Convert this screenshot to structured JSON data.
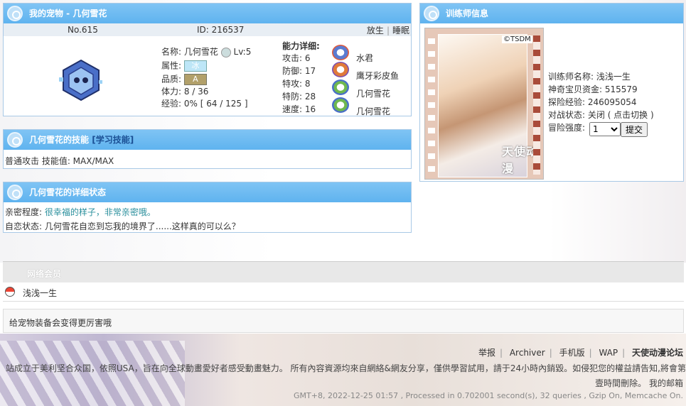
{
  "pet_panel": {
    "title": "我的宠物 - 几何雪花",
    "number": "No.615",
    "id_label": "ID: 216537",
    "release": "放生",
    "sleep": "睡眠",
    "name_label": "名称:",
    "name": "几何雪花",
    "level": "Lv:5",
    "attr_label": "属性:",
    "attr": "冰",
    "quality_label": "品质:",
    "quality": "A",
    "hp": "体力: 8 / 36",
    "exp": "经验: 0% [ 64 / 125 ]",
    "abilities_title": "能力详细:",
    "stats": [
      {
        "label": "攻击: 6",
        "pokemon": "水君"
      },
      {
        "label": "防御: 17",
        "pokemon": "鹰牙彩皮鱼"
      },
      {
        "label": "特攻: 8",
        "pokemon": "几何雪花"
      },
      {
        "label": "特防: 28",
        "pokemon": "几何雪花"
      },
      {
        "label": "速度: 16",
        "pokemon": ""
      }
    ]
  },
  "skills_panel": {
    "title": "几何雪花的技能",
    "learn_link": "[学习技能]",
    "text": "普通攻击 技能值: MAX/MAX"
  },
  "detail_panel": {
    "title": "几何雪花的详细状态",
    "intimacy_label": "亲密程度:",
    "intimacy_value": "很幸福的样子，非常亲密哦。",
    "narc_label": "自恋状态:",
    "narc_value": "几何雪花自恋到忘我的境界了......这样真的可以么？"
  },
  "trainer_panel": {
    "title": "训练师信息",
    "name": "训练师名称: 浅浅一生",
    "money": "神奇宝贝资金: 515579",
    "exp": "探险经验: 246095054",
    "battle": "对战状态: 关闭",
    "battle_toggle": "( 点击切换 )",
    "risk_label": "冒险强度:",
    "risk_value": "1",
    "submit": "提交",
    "avatar_text_1": "©TSDM",
    "avatar_text_2": "天使动漫"
  },
  "online": {
    "title": "网络会员",
    "member": "浅浅一生"
  },
  "tip": "给宠物装备会变得更厉害哦",
  "footer": {
    "links": [
      "举报",
      "Archiver",
      "手机版",
      "WAP",
      "天使动漫论坛"
    ],
    "disclaimer": "站成立于美利坚合众国，依照USA，旨在向全球動畫愛好者感受動畫魅力。 所有內容資源均來自網絡&網友分享，僅供學習試用，請于24小時內銷毀。如侵犯您的權益請告知,將會第",
    "disclaimer2": "壹時間刪除。  我的邮箱",
    "stats": "GMT+8, 2022-12-25 01:57 , Processed in 0.702001 second(s), 32 queries , Gzip On, Memcache On."
  }
}
